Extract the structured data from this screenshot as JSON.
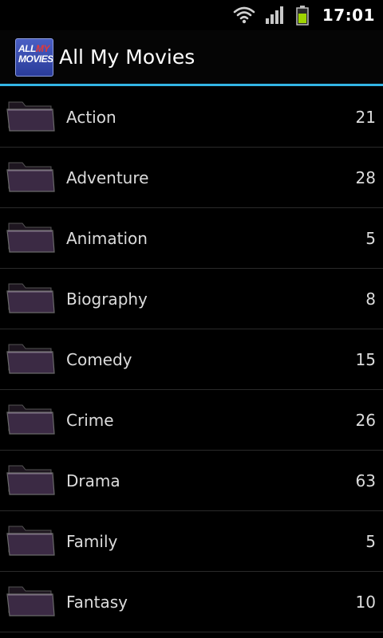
{
  "status_bar": {
    "time": "17:01",
    "icons": [
      "wifi-icon",
      "signal-icon",
      "battery-icon"
    ]
  },
  "header": {
    "logo_text_line1_a": "ALL",
    "logo_text_line1_b": "MY",
    "logo_text_line2": "MOVIES",
    "title": "All My Movies"
  },
  "genres": [
    {
      "label": "Action",
      "count": "21"
    },
    {
      "label": "Adventure",
      "count": "28"
    },
    {
      "label": "Animation",
      "count": "5"
    },
    {
      "label": "Biography",
      "count": "8"
    },
    {
      "label": "Comedy",
      "count": "15"
    },
    {
      "label": "Crime",
      "count": "26"
    },
    {
      "label": "Drama",
      "count": "63"
    },
    {
      "label": "Family",
      "count": "5"
    },
    {
      "label": "Fantasy",
      "count": "10"
    }
  ],
  "colors": {
    "accent": "#33b5e5",
    "background": "#000000",
    "folder": "#3b2a44"
  }
}
